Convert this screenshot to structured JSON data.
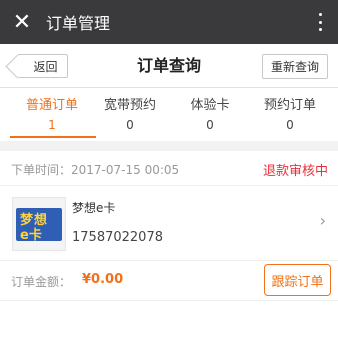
{
  "window": {
    "title": "订单管理",
    "close_icon": "✕"
  },
  "navbar": {
    "back_label": "返回",
    "title": "订单查询",
    "requery_label": "重新查询"
  },
  "tabs": [
    {
      "label": "普通订单",
      "count": "1",
      "active": true
    },
    {
      "label": "宽带预约",
      "count": "0",
      "active": false
    },
    {
      "label": "体验卡",
      "count": "0",
      "active": false
    },
    {
      "label": "预约订单",
      "count": "0",
      "active": false
    }
  ],
  "order": {
    "time_label": "下单时间：",
    "time_value": "2017-07-15  00:05",
    "status": "退款审核中",
    "thumb_line1": "梦想",
    "thumb_line2": "e卡",
    "product_name": "梦想e卡",
    "phone": "17587022078",
    "amount_label": "订单金额：",
    "amount": "¥0.00",
    "track_label": "跟踪订单",
    "chevron": "›"
  },
  "colors": {
    "accent": "#f0711a",
    "status_red": "#e8313a",
    "titlebar": "#3a3a3c"
  }
}
